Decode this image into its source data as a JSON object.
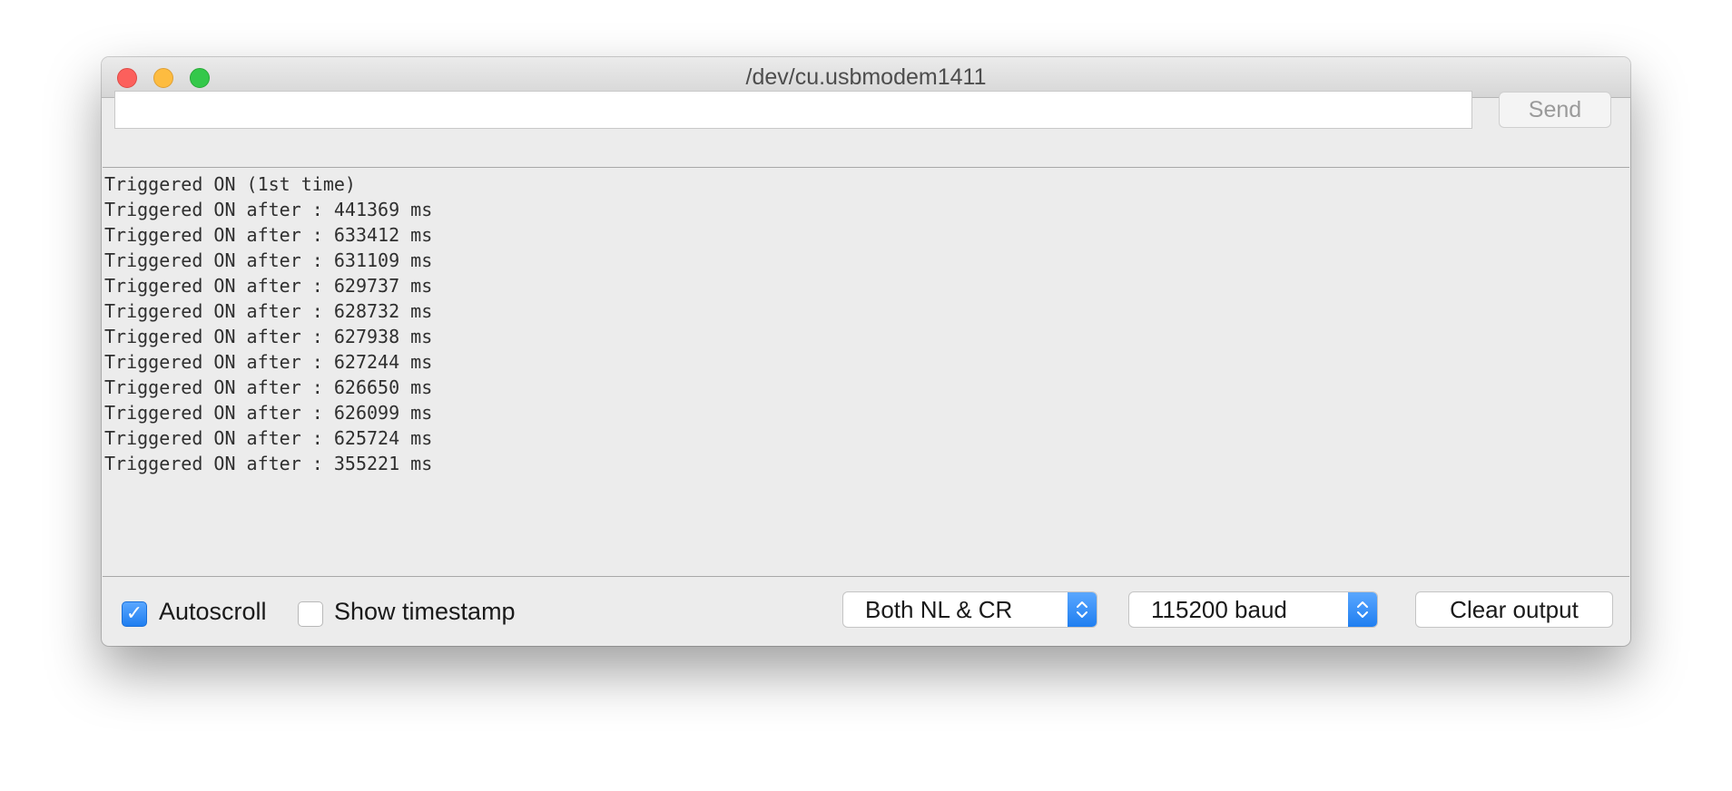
{
  "window": {
    "title": "/dev/cu.usbmodem1411"
  },
  "toolbar": {
    "input_value": "",
    "send_label": "Send"
  },
  "output": {
    "lines": [
      "Triggered ON (1st time)",
      "Triggered ON after : 441369 ms",
      "Triggered ON after : 633412 ms",
      "Triggered ON after : 631109 ms",
      "Triggered ON after : 629737 ms",
      "Triggered ON after : 628732 ms",
      "Triggered ON after : 627938 ms",
      "Triggered ON after : 627244 ms",
      "Triggered ON after : 626650 ms",
      "Triggered ON after : 626099 ms",
      "Triggered ON after : 625724 ms",
      "Triggered ON after : 355221 ms"
    ]
  },
  "footer": {
    "autoscroll_label": "Autoscroll",
    "autoscroll_checked": true,
    "timestamp_label": "Show timestamp",
    "timestamp_checked": false,
    "line_ending_value": "Both NL & CR",
    "baud_value": "115200 baud",
    "clear_label": "Clear output"
  },
  "colors": {
    "traffic_close": "#fc605c",
    "traffic_minimize": "#fdbc40",
    "traffic_maximize": "#34c84a",
    "accent": "#1f7ef0"
  },
  "icons": {
    "checkmark": "checkmark-icon",
    "select_arrows": "up-down-chevron-icon"
  }
}
